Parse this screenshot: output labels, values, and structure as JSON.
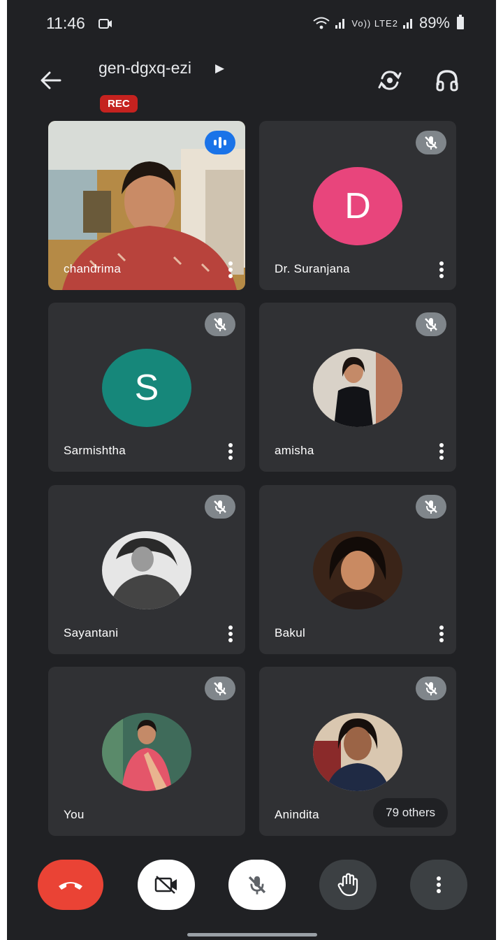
{
  "status_bar": {
    "time": "11:46",
    "network": "Vo)) LTE2",
    "battery": "89%"
  },
  "meeting": {
    "code": "gen-dgxq-ezi",
    "rec_label": "REC"
  },
  "participants": [
    {
      "name": "chandrima",
      "type": "video",
      "speaking": true
    },
    {
      "name": "Dr. Suranjana",
      "initial": "D",
      "color": "#e8457c",
      "muted": true
    },
    {
      "name": "Sarmishtha",
      "initial": "S",
      "color": "#16877a",
      "muted": true
    },
    {
      "name": "amisha",
      "type": "photo",
      "muted": true
    },
    {
      "name": "Sayantani",
      "type": "photo",
      "muted": true
    },
    {
      "name": "Bakul",
      "type": "photo",
      "muted": true
    },
    {
      "name": "You",
      "type": "photo",
      "muted": true
    },
    {
      "name": "Anindita",
      "type": "photo",
      "muted": true
    }
  ],
  "others_label": "79 others",
  "controls": {
    "end_call_color": "#ea4335",
    "camera_icon": "camera-off-icon",
    "mic_icon": "mic-off-icon",
    "hand_icon": "raise-hand-icon",
    "more_icon": "more-vert-icon"
  }
}
